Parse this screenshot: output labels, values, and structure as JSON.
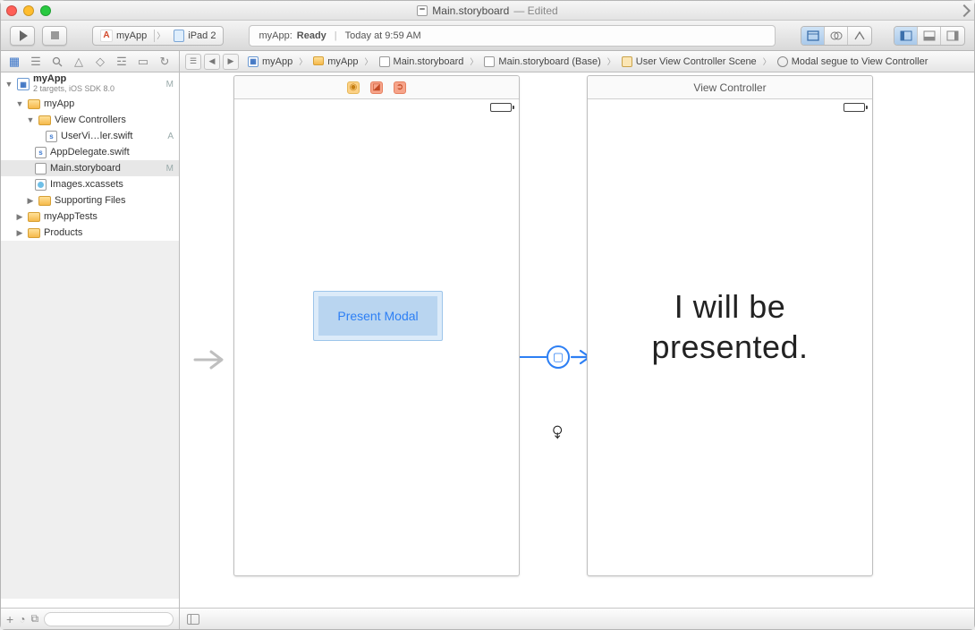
{
  "title": {
    "filename": "Main.storyboard",
    "suffix": " — Edited"
  },
  "toolbar": {
    "scheme_app": "myApp",
    "scheme_device": "iPad 2",
    "status_prefix": "myApp: ",
    "status_state": "Ready",
    "status_time": "Today at 9:59 AM"
  },
  "breadcrumb": {
    "p0": "myApp",
    "p1": "myApp",
    "p2": "Main.storyboard",
    "p3": "Main.storyboard (Base)",
    "p4": "User View Controller Scene",
    "p5": "Modal segue to View Controller"
  },
  "navigator": {
    "project": "myApp",
    "project_sub": "2 targets, iOS SDK 8.0",
    "project_badge": "M",
    "g0": "myApp",
    "g1": "View Controllers",
    "f_user": "UserVi…ler.swift",
    "f_user_badge": "A",
    "f_appdel": "AppDelegate.swift",
    "f_main": "Main.storyboard",
    "f_main_badge": "M",
    "f_images": "Images.xcassets",
    "g2": "Supporting Files",
    "g3": "myAppTests",
    "g4": "Products"
  },
  "scene1": {
    "button_label": "Present Modal"
  },
  "scene2": {
    "title": "View Controller",
    "big_text_l1": "I will be",
    "big_text_l2": "presented."
  }
}
